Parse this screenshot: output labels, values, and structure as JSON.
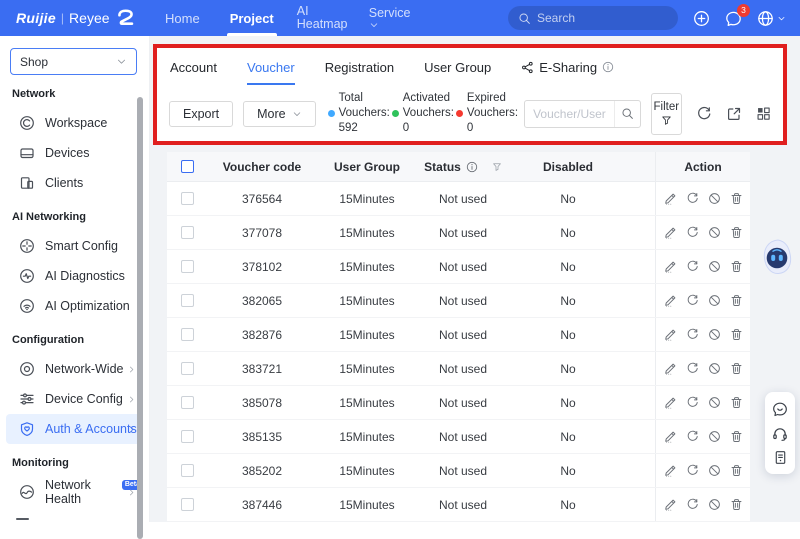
{
  "navbar": {
    "brand": {
      "part1": "Ruijie",
      "part2": "Reyee"
    },
    "items": [
      {
        "label": "Home"
      },
      {
        "label": "Project"
      },
      {
        "label": "AI Heatmap"
      },
      {
        "label": "Service"
      }
    ],
    "active_item": "Project",
    "search_placeholder": "Search",
    "notification_badge": "3"
  },
  "sidebar": {
    "scope": "Shop",
    "groups": [
      {
        "label": "Network",
        "items": [
          {
            "label": "Workspace"
          },
          {
            "label": "Devices"
          },
          {
            "label": "Clients"
          }
        ]
      },
      {
        "label": "AI Networking",
        "items": [
          {
            "label": "Smart Config"
          },
          {
            "label": "AI Diagnostics"
          },
          {
            "label": "AI Optimization"
          }
        ]
      },
      {
        "label": "Configuration",
        "items": [
          {
            "label": "Network-Wide"
          },
          {
            "label": "Device Config"
          },
          {
            "label": "Auth & Accounts"
          }
        ]
      },
      {
        "label": "Monitoring",
        "items": [
          {
            "label": "Network Health",
            "badge": "Beta"
          }
        ]
      }
    ],
    "active_item": "Auth & Accounts"
  },
  "tabs": {
    "items": [
      {
        "label": "Account"
      },
      {
        "label": "Voucher"
      },
      {
        "label": "Registration"
      },
      {
        "label": "User Group"
      },
      {
        "label": "E-Sharing"
      }
    ],
    "active": "Voucher"
  },
  "toolbar": {
    "export_label": "Export",
    "more_label": "More",
    "stats": [
      {
        "label": "Total Vouchers:",
        "value": "592",
        "dot_color": "#40a9ff"
      },
      {
        "label": "Activated Vouchers:",
        "value": "0",
        "dot_color": "#2fc25b"
      },
      {
        "label": "Expired Vouchers:",
        "value": "0",
        "dot_color": "#f5392f"
      }
    ],
    "search_placeholder": "Voucher/User group",
    "filter_label": "Filter"
  },
  "table": {
    "headers": [
      "Voucher code",
      "User Group",
      "Status",
      "Disabled",
      "Action"
    ],
    "rows": [
      {
        "code": "376564",
        "group": "15Minutes",
        "status": "Not used",
        "disabled": "No"
      },
      {
        "code": "377078",
        "group": "15Minutes",
        "status": "Not used",
        "disabled": "No"
      },
      {
        "code": "378102",
        "group": "15Minutes",
        "status": "Not used",
        "disabled": "No"
      },
      {
        "code": "382065",
        "group": "15Minutes",
        "status": "Not used",
        "disabled": "No"
      },
      {
        "code": "382876",
        "group": "15Minutes",
        "status": "Not used",
        "disabled": "No"
      },
      {
        "code": "383721",
        "group": "15Minutes",
        "status": "Not used",
        "disabled": "No"
      },
      {
        "code": "385078",
        "group": "15Minutes",
        "status": "Not used",
        "disabled": "No"
      },
      {
        "code": "385135",
        "group": "15Minutes",
        "status": "Not used",
        "disabled": "No"
      },
      {
        "code": "385202",
        "group": "15Minutes",
        "status": "Not used",
        "disabled": "No"
      },
      {
        "code": "387446",
        "group": "15Minutes",
        "status": "Not used",
        "disabled": "No"
      }
    ]
  },
  "colors": {
    "navbar_blue": "#3a6df2",
    "primary_blue": "#3a78f0",
    "annotation_red": "#e01f1f",
    "active_sidebar_bg": "#e8f1ff",
    "dot_total": "#40a9ff",
    "dot_activated": "#2fc25b",
    "dot_expired": "#f5392f"
  }
}
